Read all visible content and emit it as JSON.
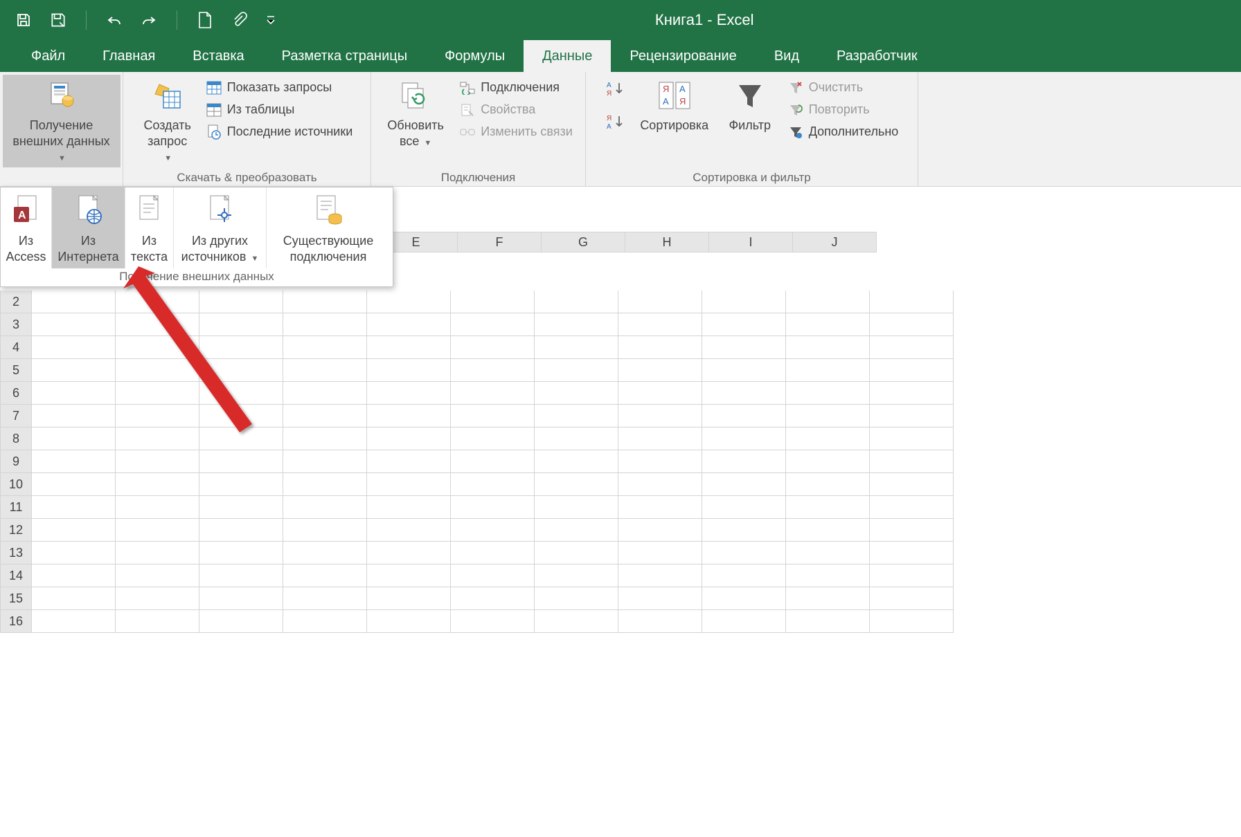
{
  "title": "Книга1 - Excel",
  "tabs": {
    "file": "Файл",
    "home": "Главная",
    "insert": "Вставка",
    "layout": "Разметка страницы",
    "formulas": "Формулы",
    "data": "Данные",
    "review": "Рецензирование",
    "view": "Вид",
    "dev": "Разработчик"
  },
  "ribbon": {
    "group1": {
      "btn": "Получение\nвнешних данных",
      "label": ""
    },
    "group2": {
      "btn": "Создать\nзапрос",
      "show": "Показать запросы",
      "table": "Из таблицы",
      "recent": "Последние источники",
      "label": "Скачать & преобразовать"
    },
    "group3": {
      "btn": "Обновить\nвсе",
      "conn": "Подключения",
      "prop": "Свойства",
      "links": "Изменить связи",
      "label": "Подключения"
    },
    "group4": {
      "sortAZ": "А↓Я",
      "sortZA": "Я↓А",
      "sort": "Сортировка",
      "filter": "Фильтр",
      "clear": "Очистить",
      "reapply": "Повторить",
      "adv": "Дополнительно",
      "label": "Сортировка и фильтр"
    }
  },
  "gallery": {
    "access": "Из\nAccess",
    "web": "Из\nИнтернета",
    "text": "Из\nтекста",
    "other": "Из других\nисточников",
    "existing": "Существующие\nподключения",
    "label": "Получение внешних данных"
  },
  "columns": [
    "E",
    "F",
    "G",
    "H",
    "I",
    "J"
  ],
  "rows": [
    "2",
    "3",
    "4",
    "5",
    "6",
    "7",
    "8",
    "9",
    "10",
    "11",
    "12",
    "13",
    "14",
    "15",
    "16"
  ]
}
